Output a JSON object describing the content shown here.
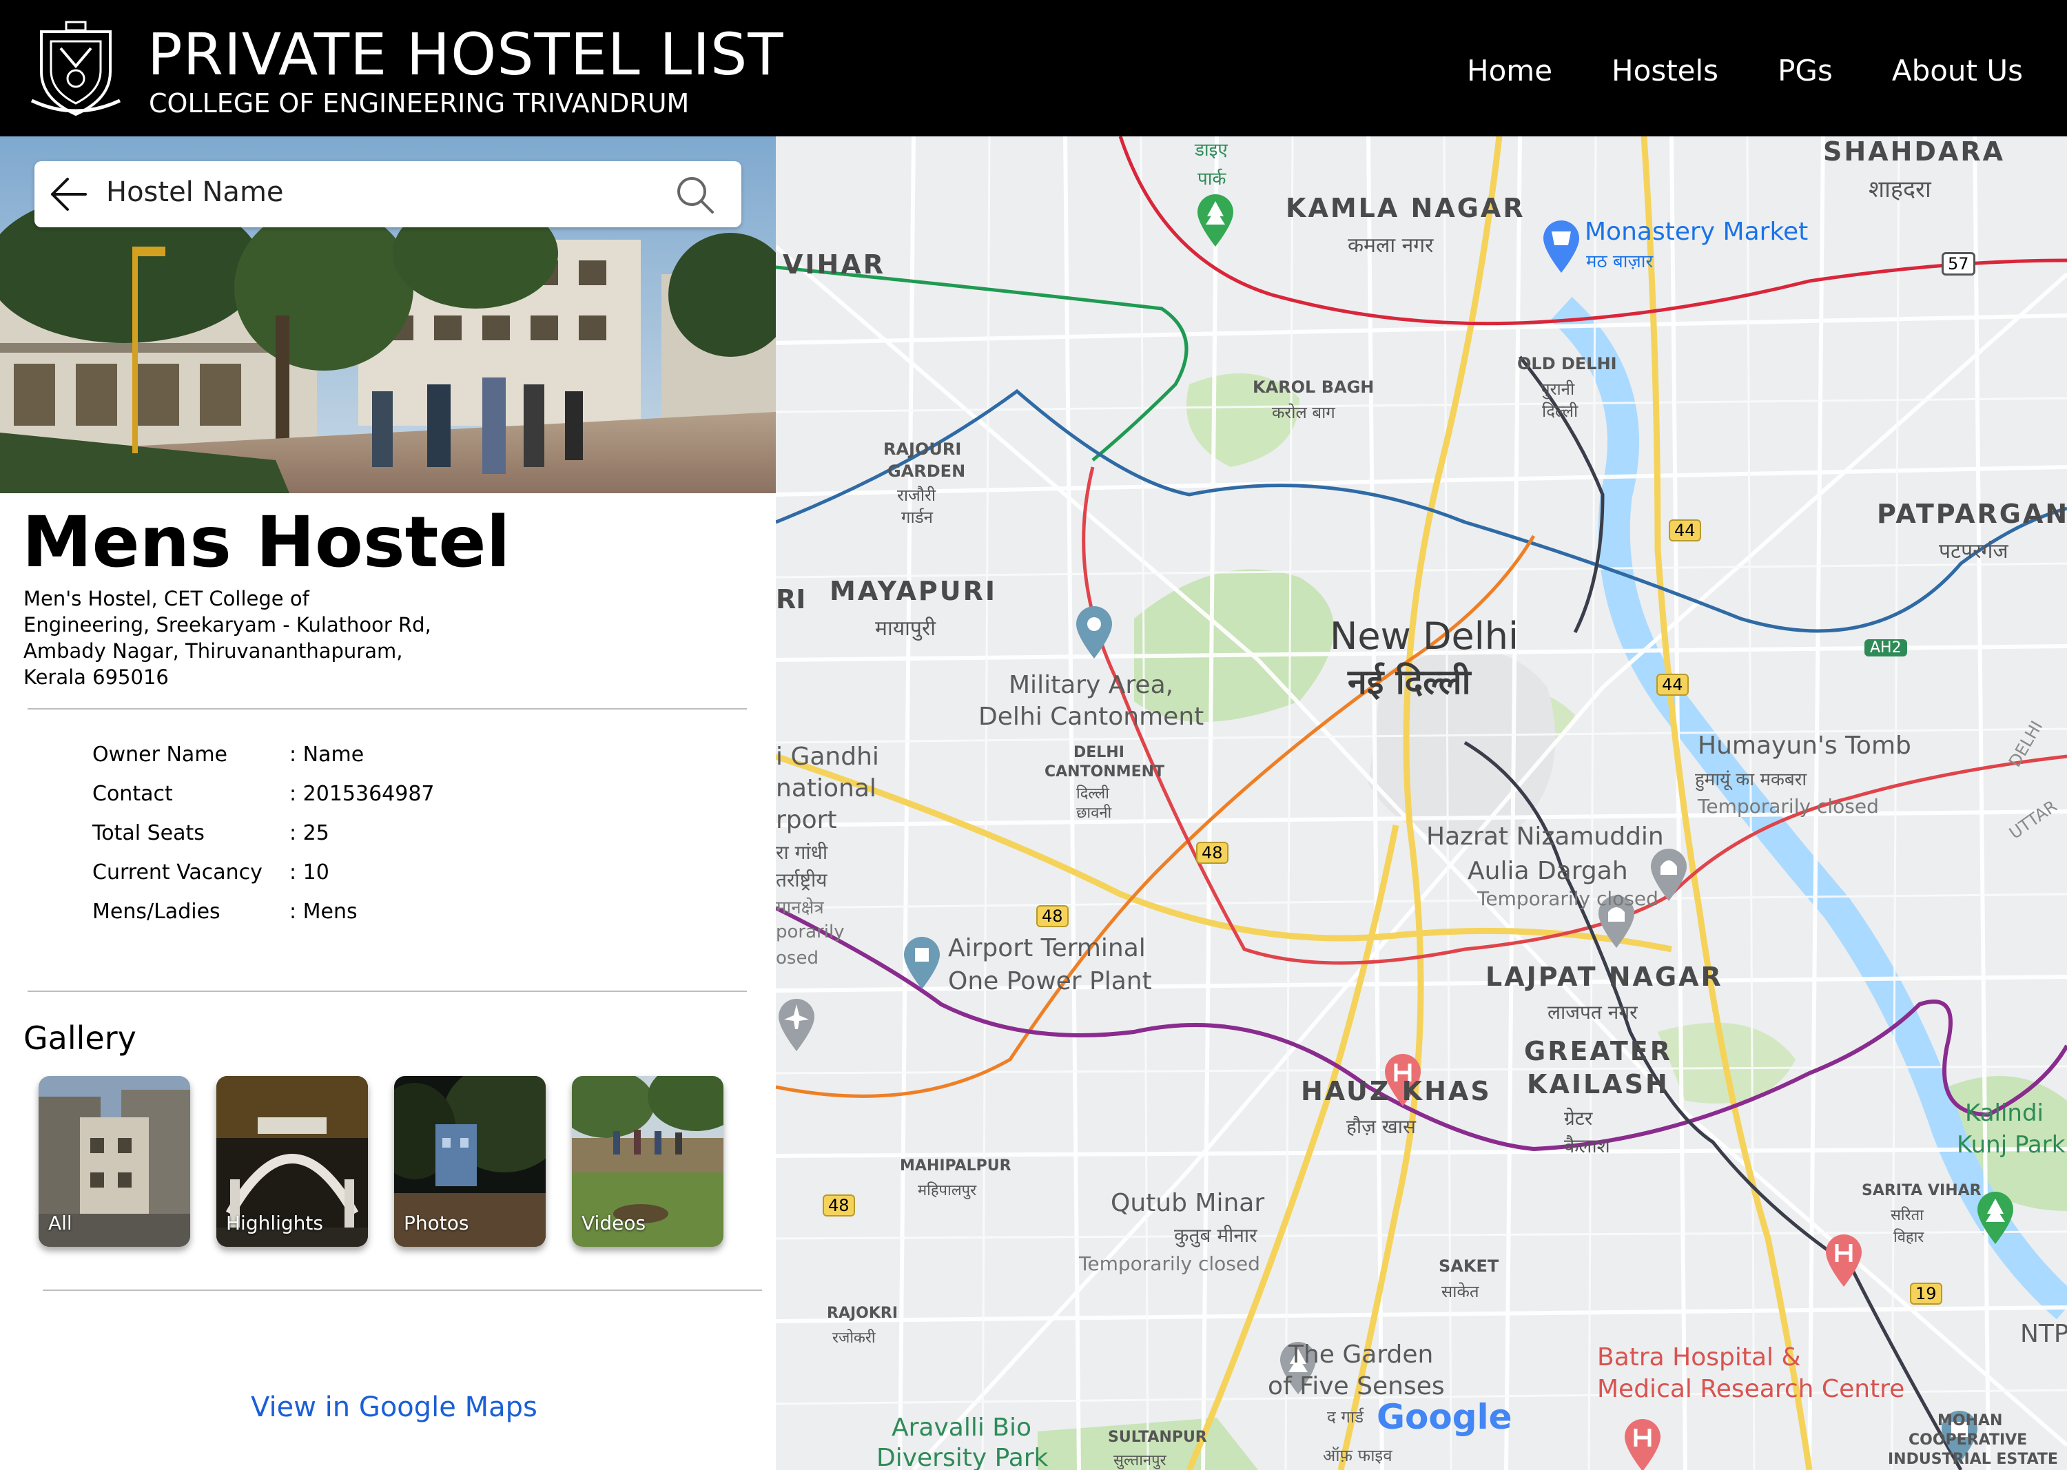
{
  "header": {
    "title": "PRIVATE HOSTEL LIST",
    "subtitle": "COLLEGE OF ENGINEERING TRIVANDRUM",
    "nav": [
      "Home",
      "Hostels",
      "PGs",
      "About Us"
    ]
  },
  "search": {
    "value": "Hostel Name"
  },
  "hostel": {
    "name": "Mens Hostel",
    "address_lines": [
      "Men's Hostel, CET College of",
      "Engineering, Sreekaryam - Kulathoor Rd,",
      "Ambady Nagar, Thiruvananthapuram,",
      "Kerala 695016"
    ],
    "details": [
      {
        "label": "Owner Name",
        "value": ": Name"
      },
      {
        "label": "Contact",
        "value": ": 2015364987"
      },
      {
        "label": "Total Seats",
        "value": ": 25"
      },
      {
        "label": "Current Vacancy",
        "value": ": 10"
      },
      {
        "label": "Mens/Ladies",
        "value": ": Mens"
      }
    ]
  },
  "gallery": {
    "title": "Gallery",
    "items": [
      "All",
      "Highlights",
      "Photos",
      "Videos"
    ]
  },
  "maps_link": "View in Google Maps",
  "map": {
    "labels": [
      {
        "text": "SHAHDARA"
      },
      {
        "text": "शाहदरा"
      },
      {
        "text": "KAMLA NAGAR"
      },
      {
        "text": "कमला नगर"
      },
      {
        "text": "Monastery Market"
      },
      {
        "text": "मठ बाज़ार"
      },
      {
        "text": "VIHAR"
      },
      {
        "text": "OLD DELHI"
      },
      {
        "text": "पुरानी"
      },
      {
        "text": "दिल्ली"
      },
      {
        "text": "KAROL BAGH"
      },
      {
        "text": "करोल बाग"
      },
      {
        "text": "RAJOURI"
      },
      {
        "text": "GARDEN"
      },
      {
        "text": "राजौरी"
      },
      {
        "text": "गार्डन"
      },
      {
        "text": "PATPARGANJ"
      },
      {
        "text": "पटपरगंज"
      },
      {
        "text": "MAYAPURI"
      },
      {
        "text": "मायापुरी"
      },
      {
        "text": "New Delhi"
      },
      {
        "text": "नई दिल्ली"
      },
      {
        "text": "Military Area,"
      },
      {
        "text": "Delhi Cantonment"
      },
      {
        "text": "DELHI"
      },
      {
        "text": "CANTONMENT"
      },
      {
        "text": "दिल्ली"
      },
      {
        "text": "छावनी"
      },
      {
        "text": "Humayun's Tomb"
      },
      {
        "text": "हुमायूं का मकबरा"
      },
      {
        "text": "Temporarily closed"
      },
      {
        "text": "Hazrat Nizamuddin"
      },
      {
        "text": "Aulia Dargah"
      },
      {
        "text": "Temporarily closed"
      },
      {
        "text": "Airport Terminal"
      },
      {
        "text": "One Power Plant"
      },
      {
        "text": "LAJPAT NAGAR"
      },
      {
        "text": "लाजपत नगर"
      },
      {
        "text": "GREATER"
      },
      {
        "text": "KAILASH"
      },
      {
        "text": "ग्रेटर"
      },
      {
        "text": "कैलाश"
      },
      {
        "text": "HAUZ KHAS"
      },
      {
        "text": "हौज़ खास"
      },
      {
        "text": "Kalindi"
      },
      {
        "text": "Kunj Park"
      },
      {
        "text": "MAHIPALPUR"
      },
      {
        "text": "महिपालपुर"
      },
      {
        "text": "Qutub Minar"
      },
      {
        "text": "कुतुब मीनार"
      },
      {
        "text": "Temporarily closed"
      },
      {
        "text": "SARITA VIHAR"
      },
      {
        "text": "सरिता"
      },
      {
        "text": "विहार"
      },
      {
        "text": "SAKET"
      },
      {
        "text": "साकेत"
      },
      {
        "text": "RAJOKRI"
      },
      {
        "text": "रजोकरी"
      },
      {
        "text": "The Garden"
      },
      {
        "text": "of Five Senses"
      },
      {
        "text": "द गार्ड"
      },
      {
        "text": "ऑफ़ फाइव"
      },
      {
        "text": "Batra Hospital &"
      },
      {
        "text": "Medical Research Centre"
      },
      {
        "text": "NTP"
      },
      {
        "text": "Aravalli Bio"
      },
      {
        "text": "Diversity Park"
      },
      {
        "text": "SULTANPUR"
      },
      {
        "text": "सुल्तानपुर"
      },
      {
        "text": "MOHAN"
      },
      {
        "text": "COOPERATIVE"
      },
      {
        "text": "INDUSTRIAL ESTATE"
      },
      {
        "text": "i Gandhi"
      },
      {
        "text": "national"
      },
      {
        "text": "rport"
      },
      {
        "text": "रा गांधी"
      },
      {
        "text": "तर्राष्ट्रीय"
      },
      {
        "text": "मानक्षेत्र"
      },
      {
        "text": "porarily"
      },
      {
        "text": "osed"
      },
      {
        "text": "RI"
      },
      {
        "text": "डाइए"
      },
      {
        "text": "पार्क"
      },
      {
        "text": "DELHI"
      },
      {
        "text": "UTTAR"
      },
      {
        "text": "Google"
      }
    ],
    "road_shields": [
      "57",
      "44",
      "44",
      "48",
      "48",
      "48",
      "19",
      "AH2"
    ]
  }
}
